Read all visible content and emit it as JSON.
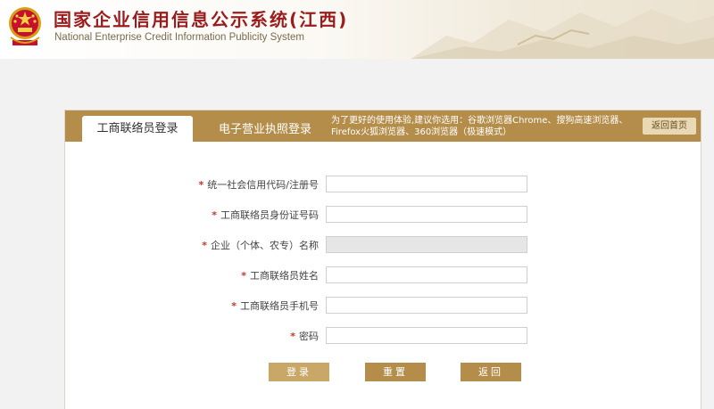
{
  "header": {
    "title": "国家企业信用信息公示系统(江西)",
    "subtitle": "National Enterprise Credit Information Publicity System"
  },
  "tabs": [
    {
      "label": "工商联络员登录",
      "active": true
    },
    {
      "label": "电子营业执照登录",
      "active": false
    }
  ],
  "notice": "为了更好的使用体验,建议你选用：谷歌浏览器Chrome、搜狗高速浏览器、Firefox火狐浏览器、360浏览器（极速模式）",
  "home_button": "返回首页",
  "form": {
    "required_mark": "*",
    "fields": [
      {
        "label": "统一社会信用代码/注册号",
        "value": "",
        "disabled": false
      },
      {
        "label": "工商联络员身份证号码",
        "value": "",
        "disabled": false
      },
      {
        "label": "企业（个体、农专）名称",
        "value": "",
        "disabled": true
      },
      {
        "label": "工商联络员姓名",
        "value": "",
        "disabled": false
      },
      {
        "label": "工商联络员手机号",
        "value": "",
        "disabled": false
      },
      {
        "label": "密码",
        "value": "",
        "disabled": false
      }
    ]
  },
  "buttons": {
    "login": "登录",
    "reset": "重置",
    "back": "返回"
  },
  "colors": {
    "accent": "#b38d49",
    "title_red": "#9b1c1c",
    "required": "#c0392b"
  },
  "icons": {
    "emblem": "national-emblem-icon"
  }
}
